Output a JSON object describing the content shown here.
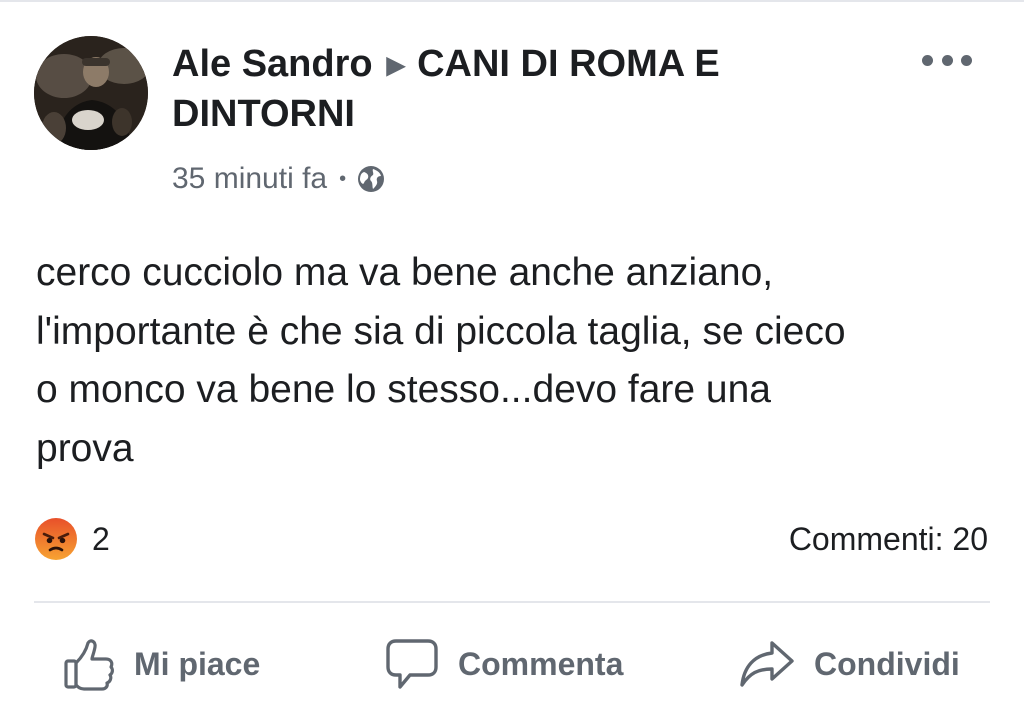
{
  "post": {
    "author": "Ale Sandro",
    "group": "CANI DI ROMA E DINTORNI",
    "group_line1": "CANI DI ROMA E",
    "group_line2": "DINTORNI",
    "separator_icon": "right-triangle-icon",
    "timestamp": "35 minuti fa",
    "meta_separator": "•",
    "privacy_icon": "globe-icon",
    "more_icon": "more-options-icon",
    "text": "cerco cucciolo  ma va bene anche anziano,\nl'importante è che sia di piccola taglia, se cieco\no monco va bene lo stesso...devo fare una\nprova"
  },
  "stats": {
    "reaction_icon": "angry-reaction-icon",
    "reaction_count": "2",
    "comments": "Commenti: 20"
  },
  "actions": {
    "like": {
      "label": "Mi piace",
      "icon": "thumbs-up-icon"
    },
    "comment": {
      "label": "Commenta",
      "icon": "comment-bubble-icon"
    },
    "share": {
      "label": "Condividi",
      "icon": "share-arrow-icon"
    }
  },
  "colors": {
    "text_primary": "#1c1e21",
    "text_secondary": "#606770",
    "divider": "#e4e6eb",
    "angry_reaction": "#f26a2e"
  }
}
